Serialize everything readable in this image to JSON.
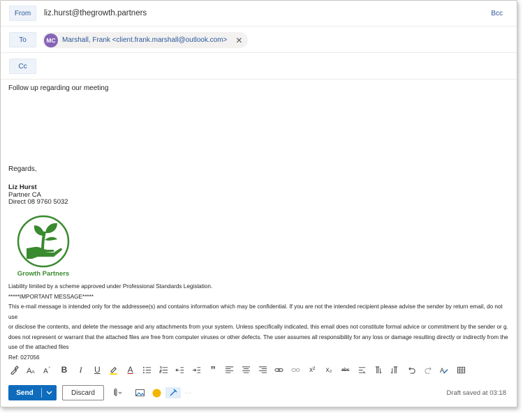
{
  "compose": {
    "from": {
      "label": "From",
      "value": "liz.hurst@thegrowth.partners",
      "bcc_label": "Bcc"
    },
    "to": {
      "label": "To",
      "recipient": {
        "initials": "MC",
        "display": "Marshall, Frank <client.frank.marshall@outlook.com>"
      }
    },
    "cc": {
      "label": "Cc"
    }
  },
  "body": {
    "subject_line": "Follow up regarding our meeting",
    "regards": "Regards,",
    "signature": {
      "name": "Liz Hurst",
      "title": "Partner CA",
      "phone": "Direct  08 9760 5032",
      "logo_text": "Growth Partners"
    },
    "legal": {
      "liability": "Liability limited by a scheme approved under Professional Standards Legislation.",
      "important": " *****IMPORTANT MESSAGE*****",
      "notice_1": "This e-mail message is intended only for the addressee(s) and contains information which may be confidential.  If you are not the intended recipient please advise the sender by return email, do not use",
      "notice_2": "or disclose the contents, and delete the message and any attachments from your system.  Unless specifically indicated, this email does not constitute formal advice or commitment by the sender or g.",
      "notice_3": "does not represent or warrant that the attached files are free from computer viruses or other defects. The user assumes all responsibility for any loss or damage resulting directly or indirectly from the",
      "notice_4": "use of the attached files",
      "ref": "Ref: 027056"
    }
  },
  "toolbar": {
    "icons": [
      "format-painter-icon",
      "font-size-icon",
      "font-grow-icon",
      "bold-icon",
      "italic-icon",
      "underline-icon",
      "highlight-icon",
      "font-color-icon",
      "bullets-icon",
      "numbering-icon",
      "decrease-indent-icon",
      "increase-indent-icon",
      "quote-icon",
      "align-left-icon",
      "align-center-icon",
      "align-right-icon",
      "link-icon",
      "unlink-icon",
      "superscript-icon",
      "subscript-icon",
      "strikethrough-icon",
      "more-format-icon",
      "ltr-icon",
      "rtl-icon",
      "undo-icon",
      "redo-icon",
      "clear-format-icon",
      "table-icon"
    ],
    "bold_glyph": "B",
    "italic_glyph": "I",
    "underline_glyph": "U",
    "font_color_glyph": "A",
    "quote_glyph": "”",
    "sup_glyph": "x²",
    "sub_glyph": "x₂",
    "strike_glyph": "abc"
  },
  "footer": {
    "send_label": "Send",
    "discard_label": "Discard",
    "draft_status": "Draft saved at 03:18"
  },
  "colors": {
    "accent": "#0f6cbd",
    "avatar": "#8764b8",
    "logo_green": "#3a8a2f",
    "link": "#2b579a"
  }
}
